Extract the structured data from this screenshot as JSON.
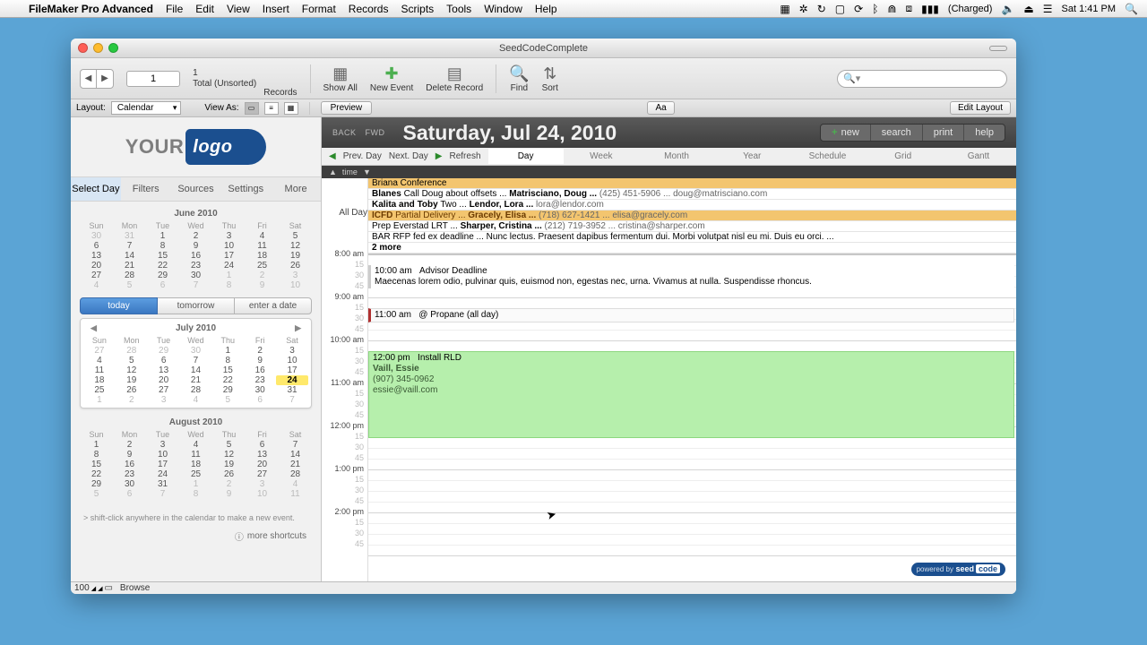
{
  "menubar": {
    "app": "FileMaker Pro Advanced",
    "menus": [
      "File",
      "Edit",
      "View",
      "Insert",
      "Format",
      "Records",
      "Scripts",
      "Tools",
      "Window",
      "Help"
    ],
    "battery": "(Charged)",
    "clock": "Sat 1:41 PM"
  },
  "window": {
    "title": "SeedCodeComplete"
  },
  "toolbar": {
    "record_current": "1",
    "record_total": "1",
    "record_sort": "Total (Unsorted)",
    "records_label": "Records",
    "show_all": "Show All",
    "new_event": "New Event",
    "delete_record": "Delete Record",
    "find": "Find",
    "sort": "Sort"
  },
  "layoutbar": {
    "layout_label": "Layout:",
    "layout_value": "Calendar",
    "view_as": "View As:",
    "preview": "Preview",
    "aa": "Aa",
    "edit_layout": "Edit Layout"
  },
  "sidebar": {
    "tabs": [
      "Select Day",
      "Filters",
      "Sources",
      "Settings",
      "More"
    ],
    "date_buttons": {
      "today": "today",
      "tomorrow": "tomorrow",
      "enter": "enter a date"
    },
    "months": {
      "june": {
        "title": "June 2010",
        "dow": [
          "Sun",
          "Mon",
          "Tue",
          "Wed",
          "Thu",
          "Fri",
          "Sat"
        ],
        "rows": [
          [
            "30",
            "31",
            "1",
            "2",
            "3",
            "4",
            "5"
          ],
          [
            "6",
            "7",
            "8",
            "9",
            "10",
            "11",
            "12"
          ],
          [
            "13",
            "14",
            "15",
            "16",
            "17",
            "18",
            "19"
          ],
          [
            "20",
            "21",
            "22",
            "23",
            "24",
            "25",
            "26"
          ],
          [
            "27",
            "28",
            "29",
            "30",
            "1",
            "2",
            "3"
          ],
          [
            "4",
            "5",
            "6",
            "7",
            "8",
            "9",
            "10"
          ]
        ],
        "dim_start": 2,
        "dim_end_from": 31
      },
      "july": {
        "title": "July 2010",
        "dow": [
          "Sun",
          "Mon",
          "Tue",
          "Wed",
          "Thu",
          "Fri",
          "Sat"
        ],
        "rows": [
          [
            "27",
            "28",
            "29",
            "30",
            "1",
            "2",
            "3"
          ],
          [
            "4",
            "5",
            "6",
            "7",
            "8",
            "9",
            "10"
          ],
          [
            "11",
            "12",
            "13",
            "14",
            "15",
            "16",
            "17"
          ],
          [
            "18",
            "19",
            "20",
            "21",
            "22",
            "23",
            "24"
          ],
          [
            "25",
            "26",
            "27",
            "28",
            "29",
            "30",
            "31"
          ],
          [
            "1",
            "2",
            "3",
            "4",
            "5",
            "6",
            "7"
          ]
        ],
        "selected": "24"
      },
      "august": {
        "title": "August 2010",
        "dow": [
          "Sun",
          "Mon",
          "Tue",
          "Wed",
          "Thu",
          "Fri",
          "Sat"
        ],
        "rows": [
          [
            "1",
            "2",
            "3",
            "4",
            "5",
            "6",
            "7"
          ],
          [
            "8",
            "9",
            "10",
            "11",
            "12",
            "13",
            "14"
          ],
          [
            "15",
            "16",
            "17",
            "18",
            "19",
            "20",
            "21"
          ],
          [
            "22",
            "23",
            "24",
            "25",
            "26",
            "27",
            "28"
          ],
          [
            "29",
            "30",
            "31",
            "1",
            "2",
            "3",
            "4"
          ],
          [
            "5",
            "6",
            "7",
            "8",
            "9",
            "10",
            "11"
          ]
        ]
      }
    },
    "hint": "> shift-click anywhere in the calendar to make a new event.",
    "shortcuts": "more shortcuts"
  },
  "header": {
    "back": "BACK",
    "fwd": "FWD",
    "date": "Saturday, Jul 24, 2010",
    "actions": {
      "new": "new",
      "search": "search",
      "print": "print",
      "help": "help"
    }
  },
  "viewbar": {
    "prev": "Prev. Day",
    "next": "Next. Day",
    "refresh": "Refresh",
    "tabs": [
      "Day",
      "Week",
      "Month",
      "Year",
      "Schedule",
      "Grid",
      "Gantt"
    ]
  },
  "sortbar": {
    "field": "time"
  },
  "allday_label": "All Day",
  "allday": [
    {
      "cls": "briana",
      "text": "Briana Conference"
    },
    {
      "cls": "",
      "bold": "Blanes",
      "rest": " Call Doug about offsets ... ",
      "name": "Matrisciano, Doug ...",
      "ph": "(425) 451-5906",
      "em": "doug@matrisciano.com"
    },
    {
      "cls": "",
      "bold": "Kalita and Toby",
      "rest": " Two ... ",
      "name": "Lendor, Lora ...",
      "ph": "",
      "em": "lora@lendor.com"
    },
    {
      "cls": "icfd",
      "bold": "ICFD",
      "rest": " Partial Delivery ... ",
      "name": "Gracely, Elisa ...",
      "ph": "(718) 627-1421",
      "em": "elisa@gracely.com"
    },
    {
      "cls": "",
      "bold": "",
      "rest": "Prep Everstad LRT ... ",
      "name": "Sharper, Cristina ...",
      "ph": "(212) 719-3952",
      "em": "cristina@sharper.com"
    },
    {
      "cls": "",
      "bold": "",
      "rest": " BAR RFP fed ex deadline ... Nunc lectus. Praesent dapibus fermentum dui. Morbi volutpat nisl eu mi. Duis eu orci. ..."
    },
    {
      "cls": "more",
      "text": "2 more"
    }
  ],
  "timeslots": {
    "hours": [
      "8:00 am",
      "9:00 am",
      "10:00 am",
      "11:00 am",
      "12:00 pm",
      "1:00 pm",
      "2:00 pm"
    ],
    "quarters": [
      "15",
      "30",
      "45"
    ]
  },
  "events": {
    "advisor": {
      "time": "10:00 am",
      "title": "Advisor Deadline",
      "desc": "Maecenas lorem odio, pulvinar quis, euismod non, egestas nec, urna. Vivamus at nulla. Suspendisse rhoncus."
    },
    "propane": {
      "time": "11:00 am",
      "title": "@ Propane (all day)"
    },
    "rld": {
      "time": "12:00 pm",
      "title": "Install RLD",
      "contact": "Vaill, Essie",
      "phone": "(907) 345-0962",
      "email": "essie@vaill.com"
    }
  },
  "powered": {
    "by": "powered by",
    "brand": "seed",
    "code": "code"
  },
  "statusbar": {
    "zoom": "100",
    "mode": "Browse"
  }
}
